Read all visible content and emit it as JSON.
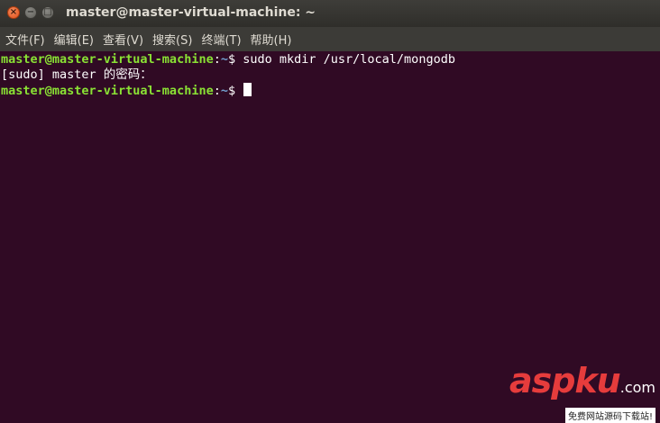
{
  "window": {
    "title": "master@master-virtual-machine: ~",
    "close_glyph": "×",
    "minimize_glyph": "−",
    "maximize_glyph": "□"
  },
  "menubar": {
    "items": [
      {
        "label": "文件(F)"
      },
      {
        "label": "编辑(E)"
      },
      {
        "label": "查看(V)"
      },
      {
        "label": "搜索(S)"
      },
      {
        "label": "终端(T)"
      },
      {
        "label": "帮助(H)"
      }
    ]
  },
  "terminal": {
    "lines": [
      {
        "user": "master@master-virtual-machine",
        "sep": ":",
        "path": "~",
        "prompt": "$ ",
        "command": "sudo mkdir /usr/local/mongodb"
      },
      {
        "text": "[sudo] master 的密码："
      },
      {
        "user": "master@master-virtual-machine",
        "sep": ":",
        "path": "~",
        "prompt": "$ ",
        "command": ""
      }
    ]
  },
  "watermark": {
    "logo": "aspku",
    "domain": ".com",
    "tagline": "免费网站源码下载站!"
  },
  "colors": {
    "terminal_bg": "#300a24",
    "user_green": "#8ae234",
    "path_blue": "#729fcf",
    "titlebar_bg": "#3c3b37",
    "close_orange": "#e0501a",
    "watermark_red": "#e63c3c"
  }
}
